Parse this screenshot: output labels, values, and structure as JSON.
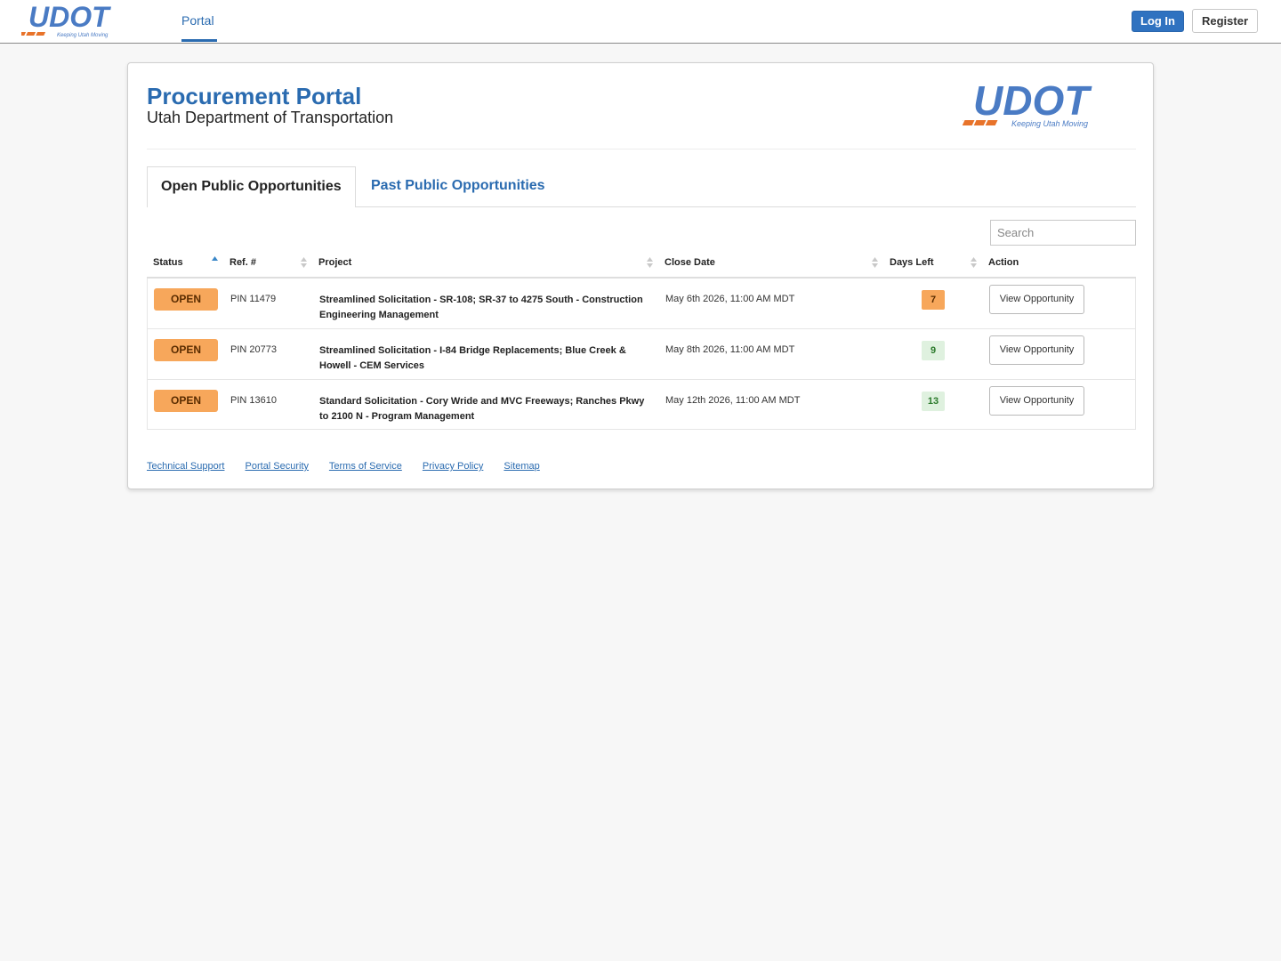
{
  "nav": {
    "logo_text": "UDOT",
    "logo_tagline": "Keeping Utah Moving",
    "portal_label": "Portal",
    "login_label": "Log In",
    "register_label": "Register"
  },
  "header": {
    "title": "Procurement Portal",
    "subtitle": "Utah Department of Transportation"
  },
  "tabs": [
    {
      "label": "Open Public Opportunities",
      "active": true
    },
    {
      "label": "Past Public Opportunities",
      "active": false
    }
  ],
  "search": {
    "placeholder": "Search"
  },
  "table": {
    "columns": [
      "Status",
      "Ref. #",
      "Project",
      "Close Date",
      "Days Left",
      "Action"
    ],
    "rows": [
      {
        "status": "OPEN",
        "ref": "PIN 11479",
        "project": "Streamlined Solicitation - SR-108; SR-37 to 4275 South - Construction Engineering Management",
        "close_date": "May 6th 2026, 11:00 AM MDT",
        "days_left": "7",
        "action": "View Opportunity"
      },
      {
        "status": "OPEN",
        "ref": "PIN 20773",
        "project": "Streamlined Solicitation - I-84 Bridge Replacements; Blue Creek & Howell - CEM Services",
        "close_date": "May 8th 2026, 11:00 AM MDT",
        "days_left": "9",
        "action": "View Opportunity"
      },
      {
        "status": "OPEN",
        "ref": "PIN 13610",
        "project": "Standard Solicitation - Cory Wride and MVC Freeways; Ranches Pkwy to 2100 N - Program Management",
        "close_date": "May 12th 2026, 11:00 AM MDT",
        "days_left": "13",
        "action": "View Opportunity"
      }
    ]
  },
  "footer": {
    "links": [
      "Technical Support",
      "Portal Security",
      "Terms of Service",
      "Privacy Policy",
      "Sitemap"
    ]
  },
  "colors": {
    "brand_blue": "#2a6bb0",
    "logo_blue": "#4a7bc4",
    "logo_orange": "#e8732a",
    "status_open": "#f7a75b",
    "days_ok": "#dff1df"
  }
}
